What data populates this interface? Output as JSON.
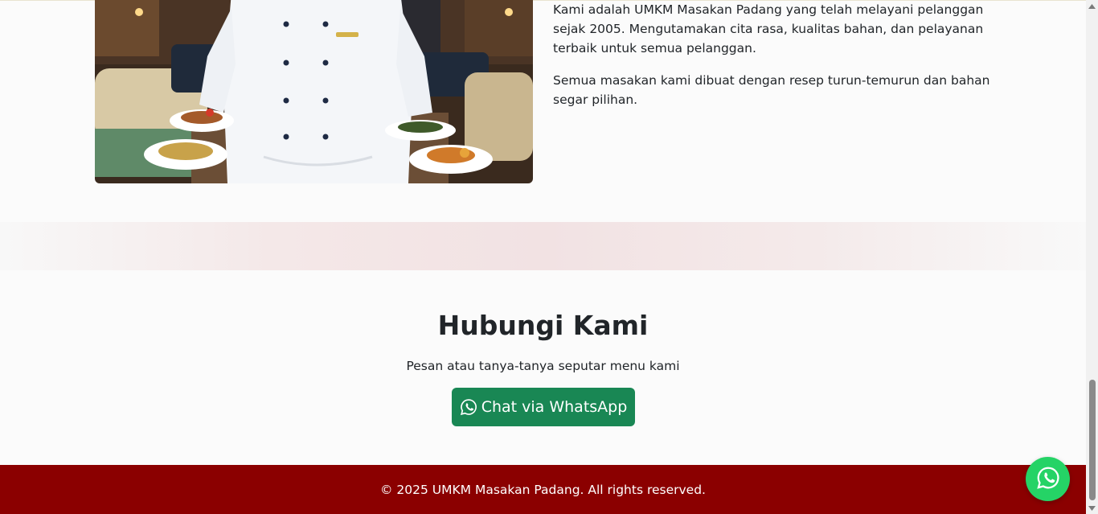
{
  "about": {
    "image_alt": "Chef holding plates of Padang dishes",
    "paragraph_1": "Kami adalah UMKM Masakan Padang yang telah melayani pelanggan sejak 2005. Mengutamakan cita rasa, kualitas bahan, dan pelayanan terbaik untuk semua pelanggan.",
    "paragraph_2": "Semua masakan kami dibuat dengan resep turun-temurun dan bahan segar pilihan."
  },
  "contact": {
    "title": "Hubungi Kami",
    "subtitle": "Pesan atau tanya-tanya seputar menu kami",
    "button_label": "Chat via WhatsApp",
    "button_icon": "whatsapp-icon"
  },
  "footer": {
    "copyright": "© 2025 UMKM Masakan Padang. All rights reserved."
  },
  "floating_button": {
    "icon": "whatsapp-icon"
  },
  "colors": {
    "footer_bg": "#8b0000",
    "button_bg": "#198754",
    "fab_bg": "#25d366",
    "text": "#212529"
  }
}
